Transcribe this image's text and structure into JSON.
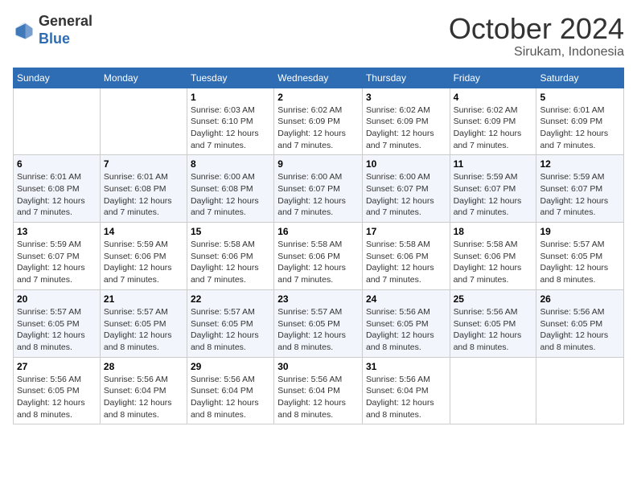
{
  "header": {
    "logo_general": "General",
    "logo_blue": "Blue",
    "month": "October 2024",
    "location": "Sirukam, Indonesia"
  },
  "weekdays": [
    "Sunday",
    "Monday",
    "Tuesday",
    "Wednesday",
    "Thursday",
    "Friday",
    "Saturday"
  ],
  "weeks": [
    [
      {
        "day": "",
        "info": ""
      },
      {
        "day": "",
        "info": ""
      },
      {
        "day": "1",
        "info": "Sunrise: 6:03 AM\nSunset: 6:10 PM\nDaylight: 12 hours and 7 minutes."
      },
      {
        "day": "2",
        "info": "Sunrise: 6:02 AM\nSunset: 6:09 PM\nDaylight: 12 hours and 7 minutes."
      },
      {
        "day": "3",
        "info": "Sunrise: 6:02 AM\nSunset: 6:09 PM\nDaylight: 12 hours and 7 minutes."
      },
      {
        "day": "4",
        "info": "Sunrise: 6:02 AM\nSunset: 6:09 PM\nDaylight: 12 hours and 7 minutes."
      },
      {
        "day": "5",
        "info": "Sunrise: 6:01 AM\nSunset: 6:09 PM\nDaylight: 12 hours and 7 minutes."
      }
    ],
    [
      {
        "day": "6",
        "info": "Sunrise: 6:01 AM\nSunset: 6:08 PM\nDaylight: 12 hours and 7 minutes."
      },
      {
        "day": "7",
        "info": "Sunrise: 6:01 AM\nSunset: 6:08 PM\nDaylight: 12 hours and 7 minutes."
      },
      {
        "day": "8",
        "info": "Sunrise: 6:00 AM\nSunset: 6:08 PM\nDaylight: 12 hours and 7 minutes."
      },
      {
        "day": "9",
        "info": "Sunrise: 6:00 AM\nSunset: 6:07 PM\nDaylight: 12 hours and 7 minutes."
      },
      {
        "day": "10",
        "info": "Sunrise: 6:00 AM\nSunset: 6:07 PM\nDaylight: 12 hours and 7 minutes."
      },
      {
        "day": "11",
        "info": "Sunrise: 5:59 AM\nSunset: 6:07 PM\nDaylight: 12 hours and 7 minutes."
      },
      {
        "day": "12",
        "info": "Sunrise: 5:59 AM\nSunset: 6:07 PM\nDaylight: 12 hours and 7 minutes."
      }
    ],
    [
      {
        "day": "13",
        "info": "Sunrise: 5:59 AM\nSunset: 6:07 PM\nDaylight: 12 hours and 7 minutes."
      },
      {
        "day": "14",
        "info": "Sunrise: 5:59 AM\nSunset: 6:06 PM\nDaylight: 12 hours and 7 minutes."
      },
      {
        "day": "15",
        "info": "Sunrise: 5:58 AM\nSunset: 6:06 PM\nDaylight: 12 hours and 7 minutes."
      },
      {
        "day": "16",
        "info": "Sunrise: 5:58 AM\nSunset: 6:06 PM\nDaylight: 12 hours and 7 minutes."
      },
      {
        "day": "17",
        "info": "Sunrise: 5:58 AM\nSunset: 6:06 PM\nDaylight: 12 hours and 7 minutes."
      },
      {
        "day": "18",
        "info": "Sunrise: 5:58 AM\nSunset: 6:06 PM\nDaylight: 12 hours and 7 minutes."
      },
      {
        "day": "19",
        "info": "Sunrise: 5:57 AM\nSunset: 6:05 PM\nDaylight: 12 hours and 8 minutes."
      }
    ],
    [
      {
        "day": "20",
        "info": "Sunrise: 5:57 AM\nSunset: 6:05 PM\nDaylight: 12 hours and 8 minutes."
      },
      {
        "day": "21",
        "info": "Sunrise: 5:57 AM\nSunset: 6:05 PM\nDaylight: 12 hours and 8 minutes."
      },
      {
        "day": "22",
        "info": "Sunrise: 5:57 AM\nSunset: 6:05 PM\nDaylight: 12 hours and 8 minutes."
      },
      {
        "day": "23",
        "info": "Sunrise: 5:57 AM\nSunset: 6:05 PM\nDaylight: 12 hours and 8 minutes."
      },
      {
        "day": "24",
        "info": "Sunrise: 5:56 AM\nSunset: 6:05 PM\nDaylight: 12 hours and 8 minutes."
      },
      {
        "day": "25",
        "info": "Sunrise: 5:56 AM\nSunset: 6:05 PM\nDaylight: 12 hours and 8 minutes."
      },
      {
        "day": "26",
        "info": "Sunrise: 5:56 AM\nSunset: 6:05 PM\nDaylight: 12 hours and 8 minutes."
      }
    ],
    [
      {
        "day": "27",
        "info": "Sunrise: 5:56 AM\nSunset: 6:05 PM\nDaylight: 12 hours and 8 minutes."
      },
      {
        "day": "28",
        "info": "Sunrise: 5:56 AM\nSunset: 6:04 PM\nDaylight: 12 hours and 8 minutes."
      },
      {
        "day": "29",
        "info": "Sunrise: 5:56 AM\nSunset: 6:04 PM\nDaylight: 12 hours and 8 minutes."
      },
      {
        "day": "30",
        "info": "Sunrise: 5:56 AM\nSunset: 6:04 PM\nDaylight: 12 hours and 8 minutes."
      },
      {
        "day": "31",
        "info": "Sunrise: 5:56 AM\nSunset: 6:04 PM\nDaylight: 12 hours and 8 minutes."
      },
      {
        "day": "",
        "info": ""
      },
      {
        "day": "",
        "info": ""
      }
    ]
  ]
}
